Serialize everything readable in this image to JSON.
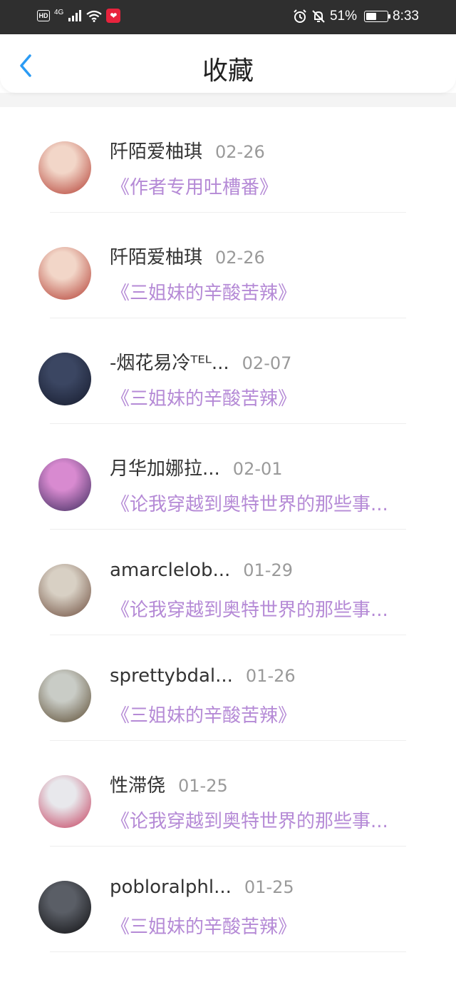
{
  "status": {
    "hd": "HD",
    "network": "4G",
    "battery_pct": "51%",
    "battery_level": 0.51,
    "time": "8:33"
  },
  "header": {
    "title": "收藏"
  },
  "items": [
    {
      "name": "阡陌爱柚琪",
      "date": "02-26",
      "title": "《作者专用吐槽番》",
      "avatar": [
        "#f2d6c8",
        "#b23a2f"
      ]
    },
    {
      "name": "阡陌爱柚琪",
      "date": "02-26",
      "title": "《三姐妹的辛酸苦辣》",
      "avatar": [
        "#f2d6c8",
        "#b23a2f"
      ]
    },
    {
      "name": "-烟花易冷ᵀᴱᴸ...",
      "date": "02-07",
      "title": "《三姐妹的辛酸苦辣》",
      "avatar": [
        "#3b4662",
        "#151a2c"
      ]
    },
    {
      "name": "月华加娜拉...",
      "date": "02-01",
      "title": "《论我穿越到奥特世界的那些事...",
      "avatar": [
        "#d88ad0",
        "#3a2a5c"
      ]
    },
    {
      "name": "amarclelob...",
      "date": "01-29",
      "title": "《论我穿越到奥特世界的那些事...",
      "avatar": [
        "#d8d0c4",
        "#6b4a3a"
      ]
    },
    {
      "name": "sprettybdal...",
      "date": "01-26",
      "title": "《三姐妹的辛酸苦辣》",
      "avatar": [
        "#c9ccc6",
        "#5a4a30"
      ]
    },
    {
      "name": "性滞侥",
      "date": "01-25",
      "title": "《论我穿越到奥特世界的那些事...",
      "avatar": [
        "#e8e8ec",
        "#c43a5a"
      ]
    },
    {
      "name": "pobloralphl...",
      "date": "01-25",
      "title": "《三姐妹的辛酸苦辣》",
      "avatar": [
        "#5a5e66",
        "#0e0e10"
      ]
    }
  ]
}
